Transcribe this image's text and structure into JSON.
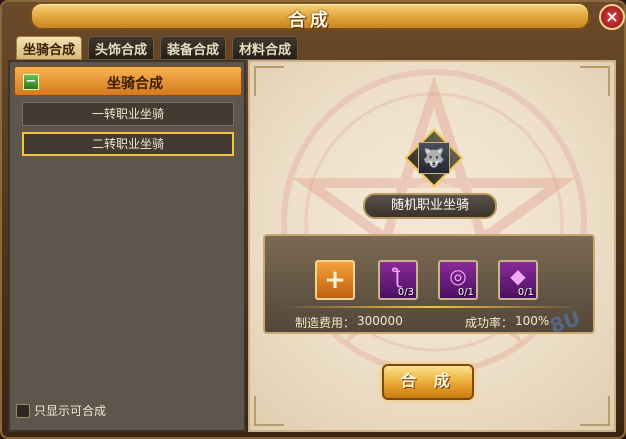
{
  "window": {
    "title": "合成",
    "close_label": "×"
  },
  "tabs": [
    {
      "label": "坐骑合成",
      "active": true
    },
    {
      "label": "头饰合成",
      "active": false
    },
    {
      "label": "装备合成",
      "active": false
    },
    {
      "label": "材料合成",
      "active": false
    }
  ],
  "sidebar": {
    "category": {
      "toggle": "−",
      "label": "坐骑合成"
    },
    "items": [
      {
        "label": "一转职业坐骑",
        "selected": false
      },
      {
        "label": "二转职业坐骑",
        "selected": true
      }
    ],
    "filter_label": "只显示可合成"
  },
  "result": {
    "name": "随机职业坐骑",
    "icon": "mount-icon"
  },
  "materials": [
    {
      "icon": "add-icon",
      "count": ""
    },
    {
      "icon": "purple-scroll-icon",
      "count": "0/3"
    },
    {
      "icon": "purple-halo-icon",
      "count": "0/1"
    },
    {
      "icon": "pink-gem-icon",
      "count": "0/1"
    }
  ],
  "cost": {
    "label": "制造费用：",
    "value": "300000"
  },
  "success": {
    "label": "成功率：",
    "value": "100%"
  },
  "craft_button": "合 成",
  "watermark": "8U",
  "colors": {
    "accent": "#f2c53d",
    "header": "#e1a43a"
  }
}
